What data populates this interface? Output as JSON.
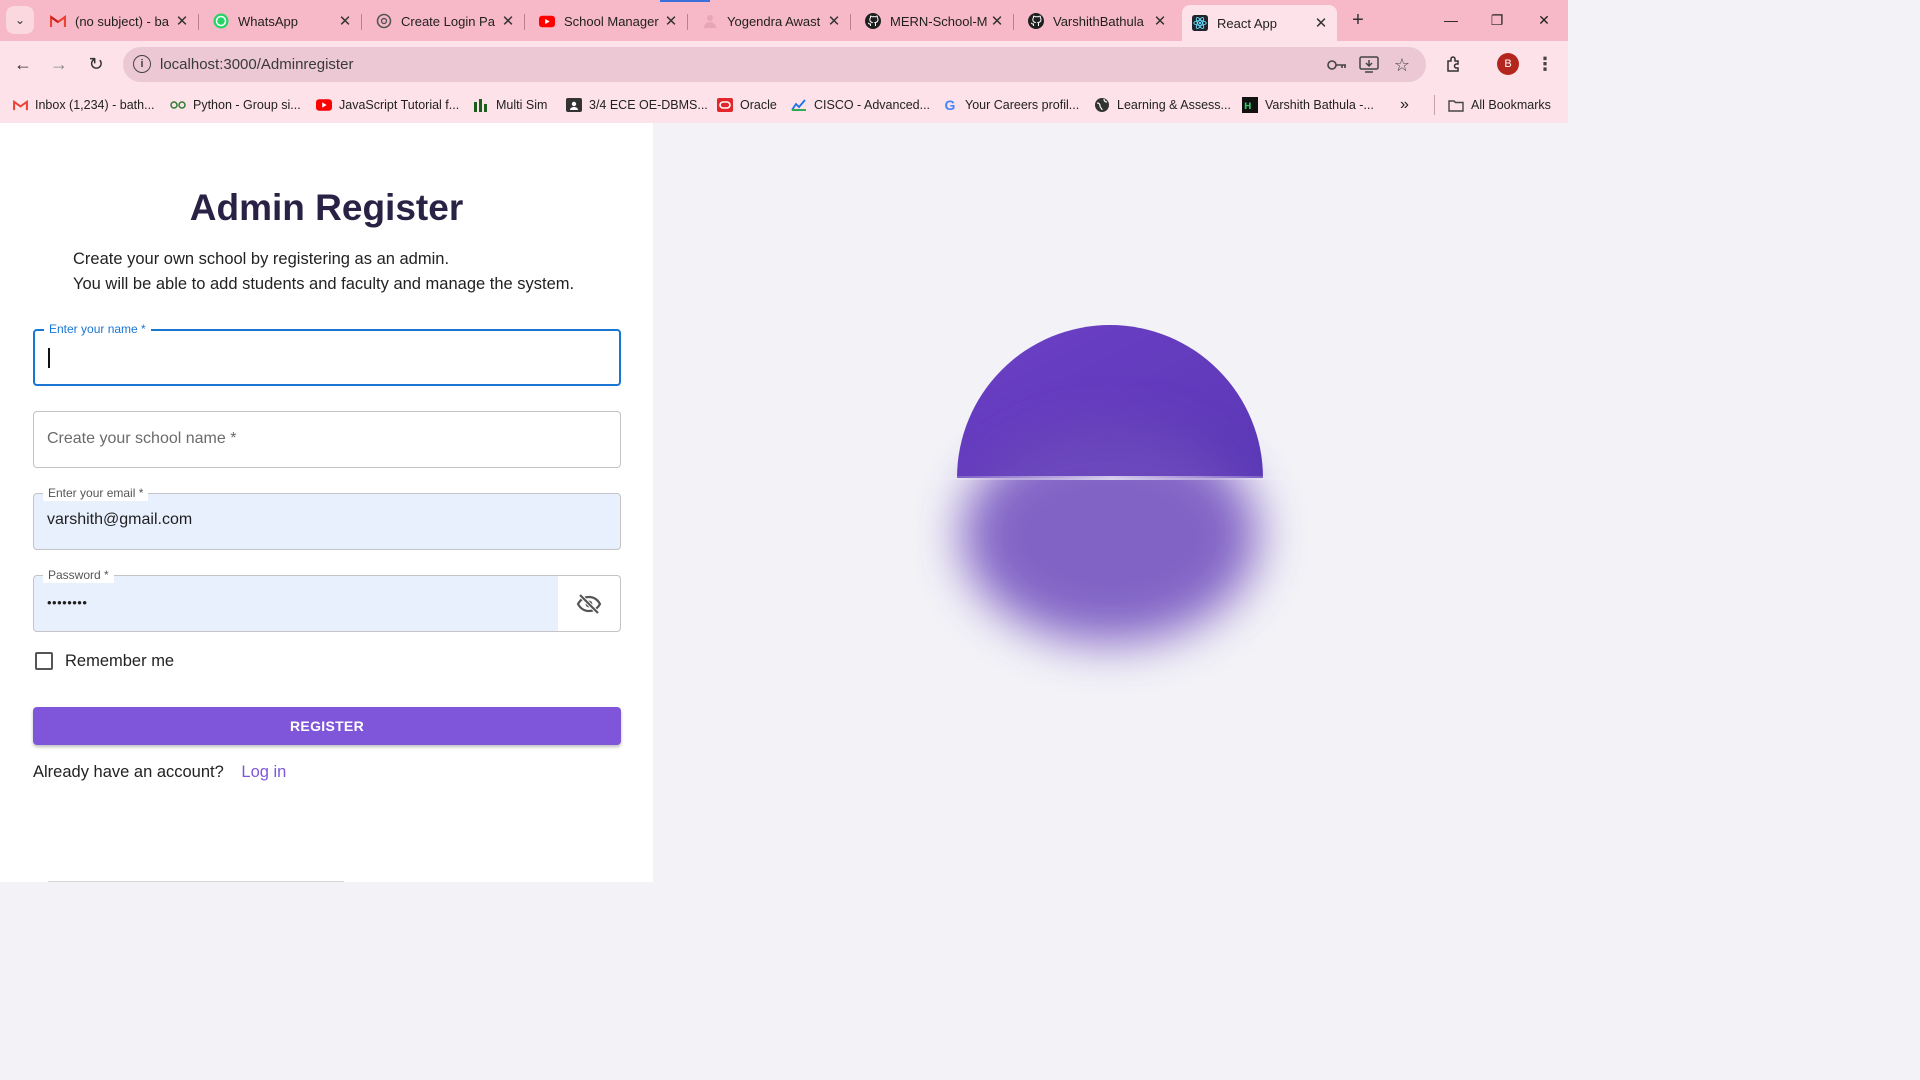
{
  "browser": {
    "tabs": [
      {
        "title": "(no subject) - ba",
        "icon": "gmail-icon"
      },
      {
        "title": "WhatsApp",
        "icon": "whatsapp-icon"
      },
      {
        "title": "Create Login Pa",
        "icon": "chatgpt-icon"
      },
      {
        "title": "School Manager",
        "icon": "youtube-icon"
      },
      {
        "title": "Yogendra Awast",
        "icon": "profile-icon"
      },
      {
        "title": "MERN-School-M",
        "icon": "github-icon"
      },
      {
        "title": "VarshithBathula",
        "icon": "github-icon"
      },
      {
        "title": "React App",
        "icon": "react-icon"
      }
    ],
    "url": "localhost:3000/Adminregister",
    "profile_initial": "B",
    "bookmarks": [
      {
        "label": "Inbox (1,234) - bath...",
        "icon": "gmail-icon"
      },
      {
        "label": "Python - Group si...",
        "icon": "python-group-icon"
      },
      {
        "label": "JavaScript Tutorial f...",
        "icon": "youtube-icon"
      },
      {
        "label": "Multi Sim",
        "icon": "multisim-icon"
      },
      {
        "label": "3/4 ECE OE-DBMS...",
        "icon": "classroom-icon"
      },
      {
        "label": "Oracle",
        "icon": "oracle-icon"
      },
      {
        "label": "CISCO - Advanced...",
        "icon": "cisco-icon"
      },
      {
        "label": "Your Careers profil...",
        "icon": "google-icon"
      },
      {
        "label": "Learning & Assess...",
        "icon": "globe-icon"
      },
      {
        "label": "Varshith Bathula -...",
        "icon": "hackerrank-icon"
      }
    ],
    "all_bookmarks": "All Bookmarks"
  },
  "form": {
    "title": "Admin Register",
    "description_line1": "Create your own school by registering as an admin.",
    "description_line2": "You will be able to add students and faculty and manage the system.",
    "name_label": "Enter your name *",
    "school_placeholder": "Create your school name *",
    "email_label": "Enter your email *",
    "email_value": "varshith@gmail.com",
    "password_label": "Password *",
    "password_value": "••••••••",
    "remember_label": "Remember me",
    "register_label": "REGISTER",
    "login_prompt": "Already have an account?",
    "login_link": "Log in"
  },
  "colors": {
    "accent": "#7f56d9",
    "focus": "#1976d2",
    "tabstrip": "#f7b9c8",
    "sun": "#6a3fbf"
  }
}
